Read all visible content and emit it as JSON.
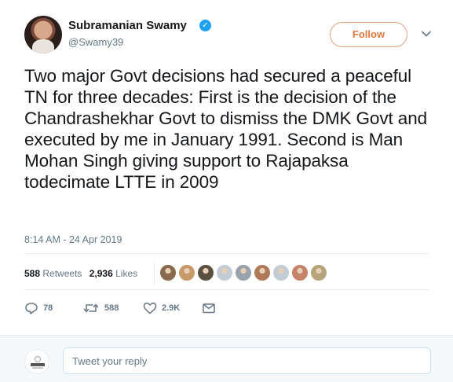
{
  "author": {
    "name": "Subramanian Swamy",
    "handle": "@Swamy39",
    "verified": true
  },
  "follow_label": "Follow",
  "tweet_text": "Two major Govt decisions had secured a peaceful TN for three decades: First is the decision of the Chandrashekhar Govt to dismiss the DMK Govt and executed by me in January 1991. Second is Man Mohan Singh giving support to Rajapaksa todecimate LTTE in 2009",
  "timestamp": "8:14 AM - 24 Apr 2019",
  "stats": {
    "retweets_count": "588",
    "retweets_label": "Retweets",
    "likes_count": "2,936",
    "likes_label": "Likes"
  },
  "liker_avatars": [
    "#8a6a4e",
    "#c89a6a",
    "#5a5040",
    "#c3ccd4",
    "#9aa3ab",
    "#b07a5a",
    "#c3ccd4",
    "#c4836a",
    "#b6a57a"
  ],
  "actions": {
    "reply_count": "78",
    "retweet_count": "588",
    "like_count": "2.9K"
  },
  "reply_box": {
    "placeholder": "Tweet your reply"
  },
  "colors": {
    "follow_accent": "#e0773e",
    "verified_blue": "#1da1f2",
    "muted_text": "#657786"
  }
}
